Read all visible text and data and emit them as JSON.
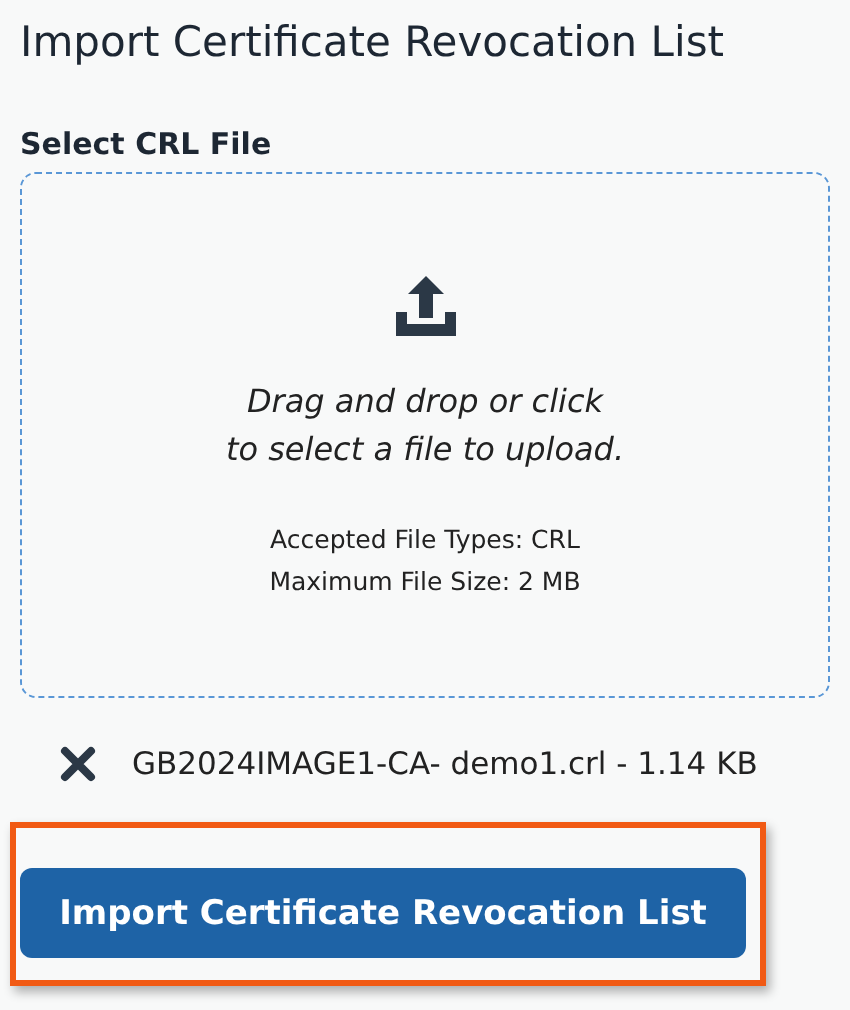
{
  "title": "Import Certificate Revocation List",
  "file_field": {
    "label": "Select CRL File",
    "instructions": [
      "Drag and drop or click",
      "to select a file to upload."
    ],
    "details": [
      "Accepted File Types: CRL",
      "Maximum File Size: 2 MB"
    ]
  },
  "files": [
    {
      "name": "GB2024IMAGE1-CA- demo1.crl - 1.14 KB"
    }
  ],
  "submit_button": {
    "label": "Import Certificate Revocation List",
    "highlighted": true
  }
}
